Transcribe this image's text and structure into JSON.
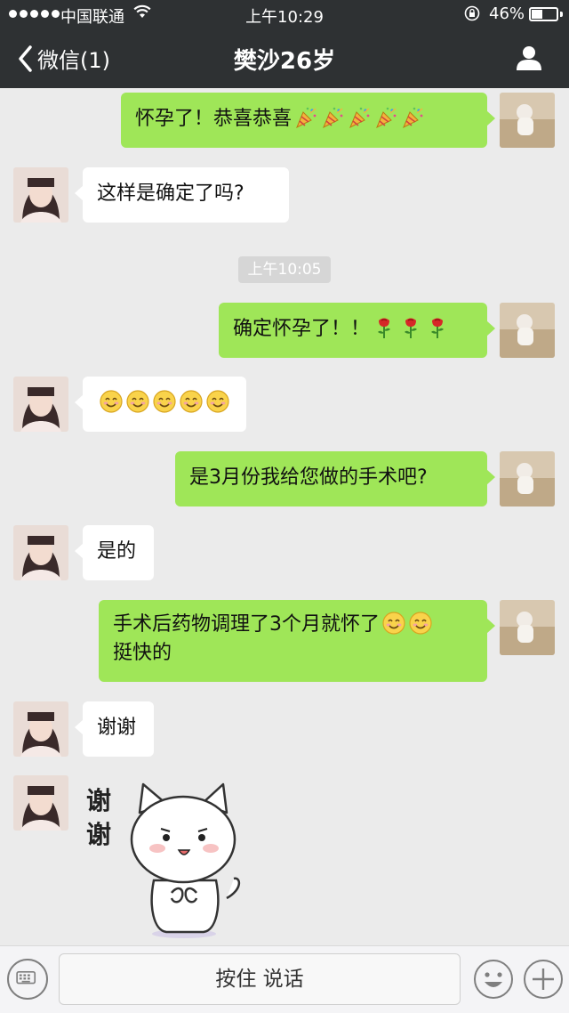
{
  "status_bar": {
    "carrier": "中国联通",
    "time": "上午10:29",
    "battery_pct": "46%",
    "battery_level": 0.46
  },
  "nav": {
    "back_label": "微信(1)",
    "title": "樊沙26岁"
  },
  "messages": [
    {
      "side": "out",
      "text": "怀孕了！恭喜恭喜",
      "emojis": [
        "party-popper",
        "party-popper",
        "party-popper",
        "party-popper",
        "party-popper"
      ]
    },
    {
      "side": "in",
      "text": "这样是确定了吗?"
    },
    {
      "timestamp": "上午10:05"
    },
    {
      "side": "out",
      "text": "确定怀孕了！！",
      "emojis": [
        "rose",
        "rose",
        "rose"
      ]
    },
    {
      "side": "in",
      "text": "",
      "emojis": [
        "smile",
        "smile",
        "smile",
        "smile",
        "smile"
      ]
    },
    {
      "side": "out",
      "text": "是3月份我给您做的手术吧?"
    },
    {
      "side": "in",
      "text": "是的"
    },
    {
      "side": "out",
      "text": "手术后药物调理了3个月就怀了",
      "text2": "挺快的",
      "emojis": [
        "smile",
        "smile"
      ]
    },
    {
      "side": "in",
      "text": "谢谢"
    },
    {
      "side": "in",
      "sticker": "cat-thanks-sticker",
      "sticker_text": "谢谢"
    }
  ],
  "input_bar": {
    "hold_to_talk": "按住 说话"
  },
  "colors": {
    "nav_bg": "#2e3133",
    "chat_bg": "#ebebeb",
    "out_bubble": "#9fe658",
    "in_bubble": "#ffffff"
  }
}
